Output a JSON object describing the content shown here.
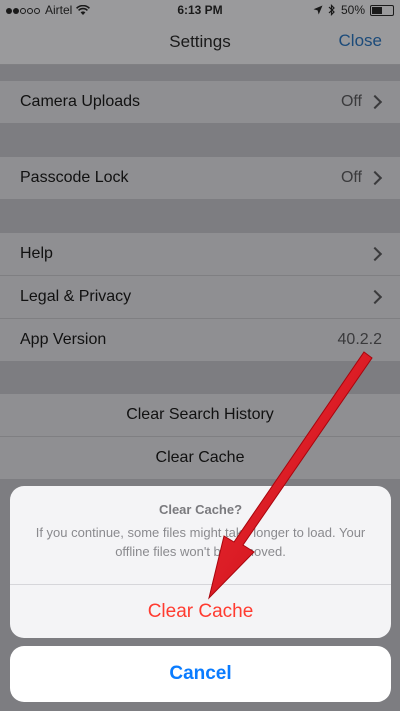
{
  "status_bar": {
    "carrier": "Airtel",
    "time": "6:13 PM",
    "battery": "50%"
  },
  "nav": {
    "title": "Settings",
    "close": "Close"
  },
  "settings": {
    "camera_uploads": {
      "label": "Camera Uploads",
      "value": "Off"
    },
    "passcode_lock": {
      "label": "Passcode Lock",
      "value": "Off"
    },
    "help": {
      "label": "Help"
    },
    "legal_privacy": {
      "label": "Legal & Privacy"
    },
    "app_version": {
      "label": "App Version",
      "value": "40.2.2"
    },
    "clear_search_history": {
      "label": "Clear Search History"
    },
    "clear_cache": {
      "label": "Clear Cache"
    }
  },
  "action_sheet": {
    "title": "Clear Cache?",
    "message": "If you continue, some files might take longer to load. Your offline files won't be removed.",
    "action": "Clear Cache",
    "cancel": "Cancel"
  },
  "colors": {
    "destructive": "#ff3b30",
    "tint": "#0a7cff",
    "annotation_arrow": "#e8101a"
  }
}
